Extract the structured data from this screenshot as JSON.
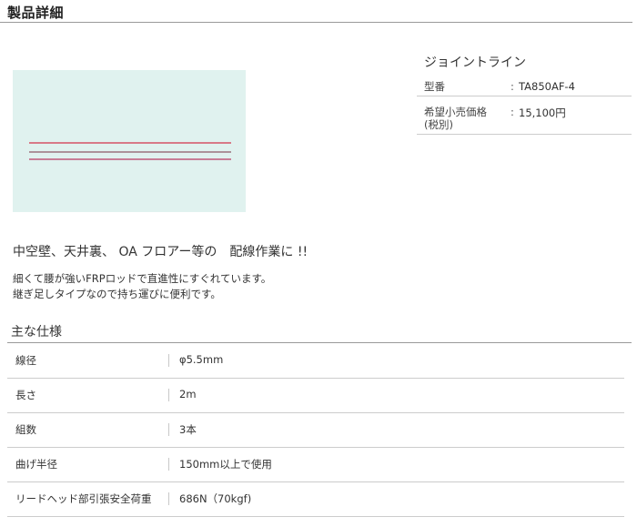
{
  "page": {
    "title": "製品詳細"
  },
  "product": {
    "name": "ジョイントライン",
    "info": [
      {
        "key": "型番",
        "value": "TA850AF-4"
      },
      {
        "key": "希望小売価格",
        "key2": "(税別)",
        "value": "15,100円"
      }
    ],
    "separator": ":",
    "headline": "中空壁、天井裏、 OA フロアー等の　配線作業に !!",
    "description": [
      "細くて腰が強いFRPロッドで直進性にすぐれています。",
      "継ぎ足しタイプなので持ち運びに便利です。"
    ],
    "image_colors": {
      "background": "#e0f2ef",
      "rod_red": "#d2324a",
      "rod_dark": "#8c5a66",
      "rod_magenta": "#b83860"
    }
  },
  "specs": {
    "title": "主な仕様",
    "rows": [
      {
        "key": "線径",
        "value": "φ5.5mm"
      },
      {
        "key": "長さ",
        "value": "2m"
      },
      {
        "key": "組数",
        "value": "3本"
      },
      {
        "key": "曲げ半径",
        "value": "150mm以上で使用"
      },
      {
        "key": "リードヘッド部引張安全荷重",
        "value": "686N（70kgf)"
      }
    ]
  }
}
